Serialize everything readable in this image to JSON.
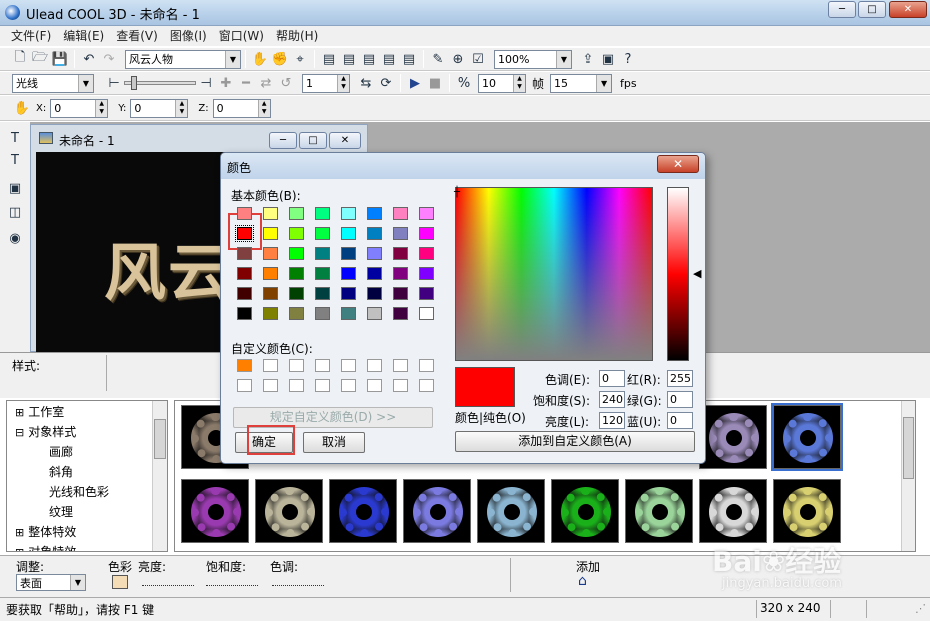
{
  "app": {
    "title": "Ulead COOL 3D - 未命名 - 1",
    "min": "─",
    "max": "□",
    "close": "✕"
  },
  "menu": [
    "文件(F)",
    "编辑(E)",
    "查看(V)",
    "图像(I)",
    "窗口(W)",
    "帮助(H)"
  ],
  "toolbar1": {
    "object_combo": "风云人物",
    "zoom_combo": "100%"
  },
  "toolbar2": {
    "light_combo": "光线",
    "frame_value": "1",
    "fps_step_value": "10",
    "frame_label": "帧",
    "fps_value": "15",
    "fps_label": "fps"
  },
  "toolbar3": {
    "x_label": "X:",
    "x_value": "0",
    "y_label": "Y:",
    "y_value": "0",
    "z_label": "Z:",
    "z_value": "0"
  },
  "document": {
    "title": "未命名 - 1",
    "canvas_text": "风云人"
  },
  "style_panel": {
    "label": "样式:"
  },
  "tree": [
    {
      "label": "工作室",
      "expander": "⊞"
    },
    {
      "label": "对象样式",
      "expander": "⊟"
    },
    {
      "label": "画廊"
    },
    {
      "label": "斜角"
    },
    {
      "label": "光线和色彩"
    },
    {
      "label": "纹理"
    },
    {
      "label": "整体特效",
      "expander": "⊞"
    },
    {
      "label": "对象特效",
      "expander": "⊞"
    }
  ],
  "thumbnails": {
    "top_row": [
      "#8a7a6a",
      "#9a8ab8",
      "#5a78d8"
    ],
    "bottom_row": [
      "#9a3ab0",
      "#bab49a",
      "#2a3ad0",
      "#7a7ae0",
      "#8ab4d0",
      "#1ab01a",
      "#9ad49a",
      "#d8d8d8",
      "#d8d070"
    ]
  },
  "adjust": {
    "label": "调整:",
    "surface_combo": "表面",
    "color_label": "色彩",
    "brightness_label": "亮度:",
    "saturation_label": "饱和度:",
    "hue_label": "色调:",
    "add_label": "添加"
  },
  "status": {
    "hint": "要获取「帮助」，请按 F1 键",
    "size": "320 x 240"
  },
  "dialog": {
    "title": "颜色",
    "close": "✕",
    "basic_colors_label": "基本颜色(B):",
    "custom_colors_label": "自定义颜色(C):",
    "basic_colors": [
      "#ff8080",
      "#ffff80",
      "#80ff80",
      "#00ff80",
      "#80ffff",
      "#0080ff",
      "#ff80c0",
      "#ff80ff",
      "#ff0000",
      "#ffff00",
      "#80ff00",
      "#00ff40",
      "#00ffff",
      "#0080c0",
      "#8080c0",
      "#ff00ff",
      "#804040",
      "#ff8040",
      "#00ff00",
      "#008080",
      "#004080",
      "#8080ff",
      "#800040",
      "#ff0080",
      "#800000",
      "#ff8000",
      "#008000",
      "#008040",
      "#0000ff",
      "#0000a0",
      "#800080",
      "#8000ff",
      "#400000",
      "#804000",
      "#004000",
      "#004040",
      "#000080",
      "#000040",
      "#400040",
      "#400080",
      "#000000",
      "#808000",
      "#808040",
      "#808080",
      "#408080",
      "#c0c0c0",
      "#400040",
      "#ffffff"
    ],
    "custom_colors": [
      "#ff8000",
      "#ffffff",
      "#ffffff",
      "#ffffff",
      "#ffffff",
      "#ffffff",
      "#ffffff",
      "#ffffff",
      "#ffffff",
      "#ffffff",
      "#ffffff",
      "#ffffff",
      "#ffffff",
      "#ffffff",
      "#ffffff",
      "#ffffff"
    ],
    "define_custom_button": "规定自定义颜色(D) >>",
    "ok_button": "确定",
    "cancel_button": "取消",
    "color_solid_label": "颜色|纯色(O)",
    "selected_color": "#ff0000",
    "hue_label": "色调(E):",
    "hue_value": "0",
    "sat_label": "饱和度(S):",
    "sat_value": "240",
    "lum_label": "亮度(L):",
    "lum_value": "120",
    "red_label": "红(R):",
    "red_value": "255",
    "green_label": "绿(G):",
    "green_value": "0",
    "blue_label": "蓝(U):",
    "blue_value": "0",
    "add_custom_button": "添加到自定义颜色(A)"
  }
}
